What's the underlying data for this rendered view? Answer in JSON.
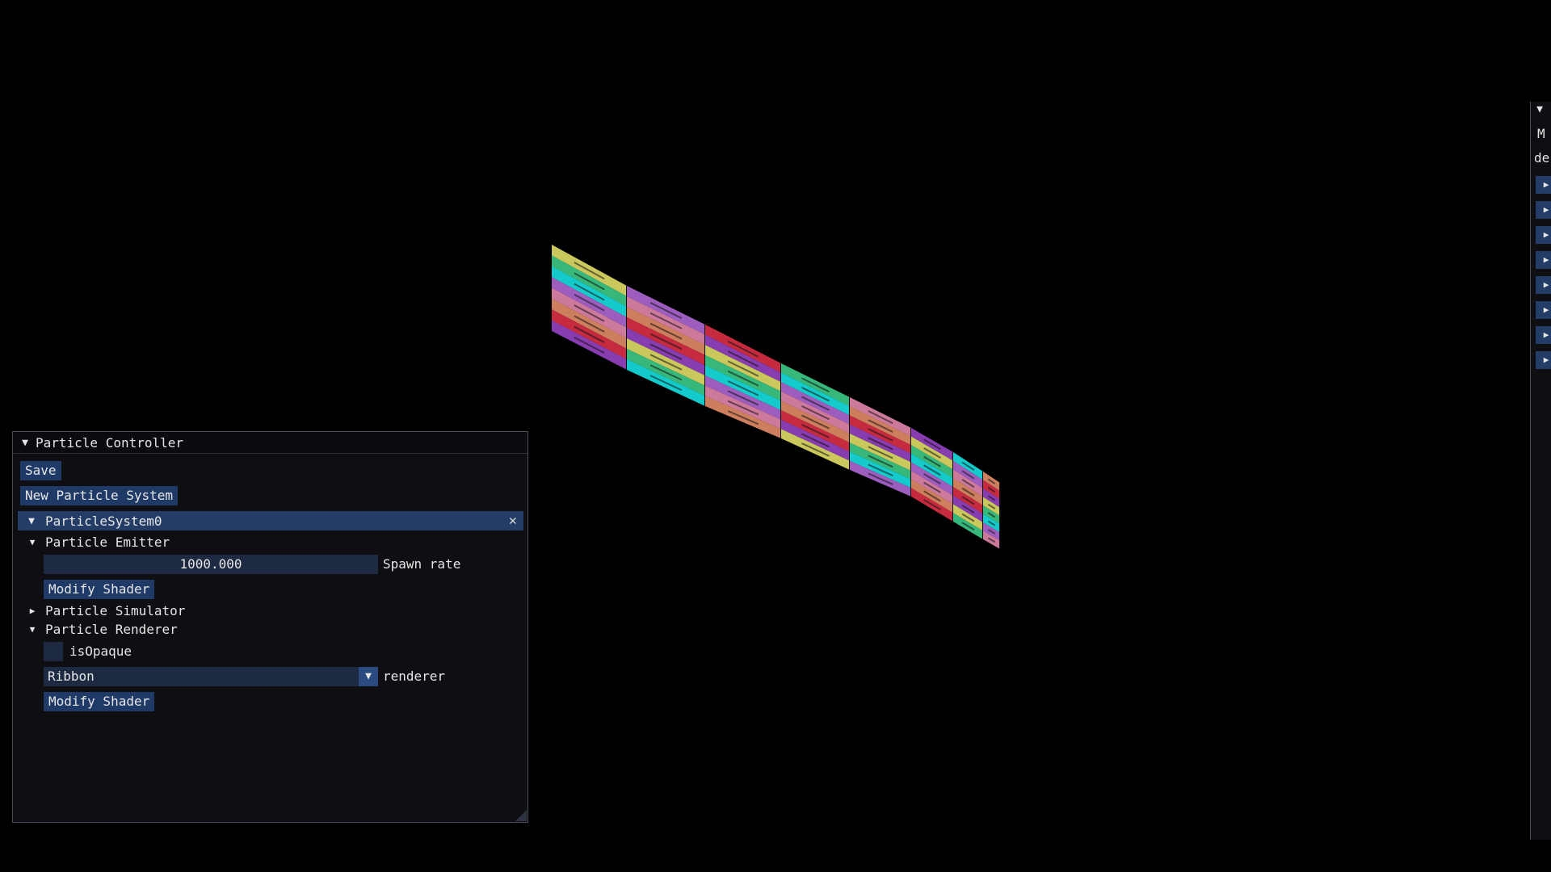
{
  "controller": {
    "title": "Particle Controller",
    "save_label": "Save",
    "new_system_label": "New Particle System",
    "system": {
      "name": "ParticleSystem0",
      "emitter": {
        "label": "Particle Emitter",
        "spawn_rate_value": "1000.000",
        "spawn_rate_label": "Spawn rate",
        "modify_shader_label": "Modify Shader"
      },
      "simulator": {
        "label": "Particle Simulator"
      },
      "renderer": {
        "label": "Particle Renderer",
        "is_opaque_label": "isOpaque",
        "is_opaque_checked": false,
        "renderer_value": "Ribbon",
        "renderer_label": "renderer",
        "modify_shader_label": "Modify Shader"
      }
    }
  },
  "right_panel": {
    "title_fragment": "M",
    "second_fragment": "de",
    "collapsed_item_count": 8
  },
  "colors": {
    "background": "#000000",
    "button": "#1f3a66",
    "header": "#233d66",
    "field": "#1d2a42",
    "ribbon_palette": [
      "#e6e26a",
      "#3fd08a",
      "#18e6e6",
      "#b36ad8",
      "#e88ab0",
      "#e8906a",
      "#e03048",
      "#9a44c8"
    ]
  }
}
